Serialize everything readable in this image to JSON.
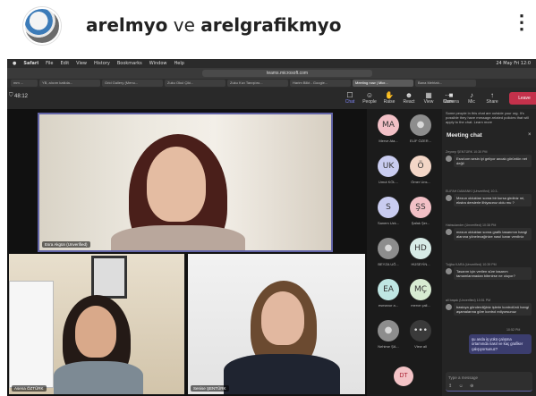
{
  "instagram": {
    "account_a": "arelmyo",
    "joiner": "ve",
    "account_b": "arelgrafikmyo",
    "more_glyph": "⋮",
    "avatar_icon": "arel-logo"
  },
  "mac_menu": [
    "Safari",
    "File",
    "Edit",
    "View",
    "History",
    "Bookmarks",
    "Window",
    "Help"
  ],
  "mac_status": "24 May Fri 12:0",
  "safari": {
    "url": "teams.microsoft.com"
  },
  "browser_tabs": [
    {
      "label": "mm ... ",
      "active": false
    },
    {
      "label": "YB, alıcım katkıla...",
      "active": false
    },
    {
      "label": "Grid Gallery (Menu...",
      "active": false
    },
    {
      "label": "Zuku Okul Çiki...",
      "active": false
    },
    {
      "label": "Zuku Kızı Tanıştıro...",
      "active": false
    },
    {
      "label": "Harim Bilkt - Google...",
      "active": false
    },
    {
      "label": "Meeting now | Micr...",
      "active": true
    },
    {
      "label": "Bana Mehtatı...",
      "active": false
    }
  ],
  "teams": {
    "timer": "48:12",
    "toolbar": [
      {
        "label": "Chat",
        "icon": "chat-icon",
        "active": true
      },
      {
        "label": "People",
        "icon": "people-icon",
        "active": false
      },
      {
        "label": "Raise",
        "icon": "raise-hand-icon",
        "active": false
      },
      {
        "label": "React",
        "icon": "react-icon",
        "active": false
      },
      {
        "label": "View",
        "icon": "view-icon",
        "active": false
      },
      {
        "label": "More",
        "icon": "more-icon",
        "active": false
      },
      {
        "label": "Camera",
        "icon": "camera-icon",
        "active": false
      },
      {
        "label": "Mic",
        "icon": "mic-icon",
        "active": false
      },
      {
        "label": "Share",
        "icon": "share-icon",
        "active": false
      }
    ],
    "leave_label": "Leave",
    "videos": {
      "main_name": "Esra Akgün (Unverified)",
      "bottom_left_name": "Asena ÖZTÜRK",
      "bottom_right_name": "Senise ŞENTÜRK"
    },
    "self_initials": "DT"
  },
  "roster": [
    {
      "initials": "MA",
      "name": "Merve Ata...",
      "color": "#f2c0c6"
    },
    {
      "initials": "",
      "name": "ELİF ÖZER...",
      "color": "#8d8d8d"
    },
    {
      "initials": "UK",
      "name": "Umut KÖL...",
      "color": "#c9ccf0"
    },
    {
      "initials": "Ö",
      "name": "Ömer Uns...",
      "color": "#f3d6c7"
    },
    {
      "initials": "S",
      "name": "Sanem Uzk...",
      "color": "#c9ccf0"
    },
    {
      "initials": "ŞS",
      "name": "Şafak Şer...",
      "color": "#f2c0c6"
    },
    {
      "initials": "",
      "name": "BEYZA UĞ...",
      "color": "#8d8d8d"
    },
    {
      "initials": "HD",
      "name": "HÜSEYİN...",
      "color": "#d7ebe6"
    },
    {
      "initials": "EA",
      "name": "esmanur a...",
      "color": "#bfe6e3"
    },
    {
      "initials": "MÇ",
      "name": "merve çali...",
      "color": "#d7ebd2"
    },
    {
      "initials": "",
      "name": "Nehirse ŞA...",
      "color": "#8d8d8d"
    },
    {
      "initials": "•••",
      "name": "View all",
      "color": "#3a3a3a"
    }
  ],
  "chat": {
    "notice": "Some people in this chat are outside your org. It's possible they have message-related policies that will apply to the chat. Learn more",
    "title": "Meeting chat",
    "messages": [
      {
        "meta": "Zeynep ŞENTÜRK  10:30 PM",
        "text": "Esra'cım sesin iyi geliyor ancak görüntün net değil"
      },
      {
        "meta": "ELİFAH DAMANKI (Unverified)  10:3..",
        "text": "Mezun oldukları sonra bir kursa girdiniz mi, ekstra derslerle ilhiyacınız oldu mu ?"
      },
      {
        "meta": "Habsulander (Unverified)  10:38 PM",
        "text": "mezun olduktan sonra grafik tasarımın hangi alanına yönelecağinize nasıl karar verdiniz"
      },
      {
        "meta": "Tuğba KARA (Unverified)  10:39 PM",
        "text": "Tasarım için verilen süre tasarım tamamlanmadan bitenirse ne oluyor?"
      },
      {
        "meta": "ali başak (Unverified)  10:51 PM",
        "text": "baskıya gönderdiğiniz işlerin kontrolünü hangi aşamalarına göre kontrol ediyorsunuz"
      }
    ],
    "own_time": "10:52 PM",
    "own_text": "şu anda iş yükü çalışma ortamında nasıl ve kaç grafiker çalışıyorsunuz?",
    "compose_placeholder": "Type a message",
    "compose_icons": "↥ ☺ ⊕"
  }
}
